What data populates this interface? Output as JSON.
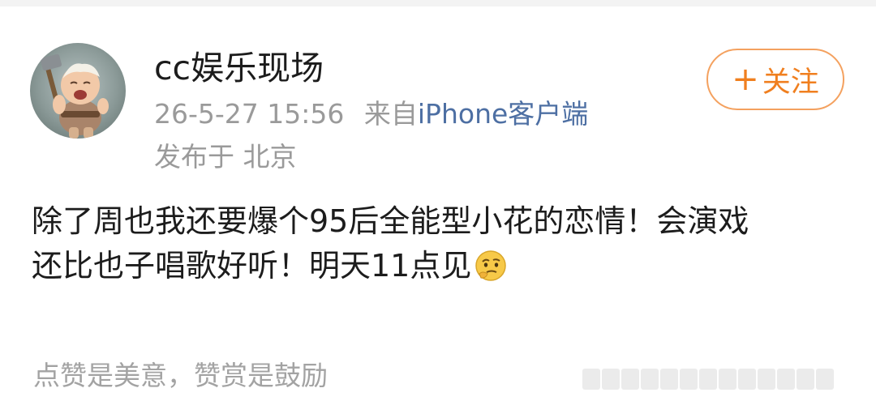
{
  "post": {
    "author": {
      "name": "cc娱乐现场",
      "avatar_icon": "baby-thor-avatar"
    },
    "timestamp": "26-5-27 15:56",
    "source_prefix": "来自",
    "source_device": "iPhone客户端",
    "location": "发布于 北京",
    "follow_button": {
      "plus": "+",
      "label": "关注"
    },
    "text_line_1": "除了周也我还要爆个95后全能型小花的恋情！会演戏",
    "text_line_2": "还比也子唱歌好听！明天11点见",
    "emoji_icon": "thinking-face-emoji",
    "footer_note": "点赞是美意，赞赏是鼓励"
  },
  "colors": {
    "follow_border": "#f4a15f",
    "follow_text": "#f07f1f",
    "device_link": "#4d6fa3",
    "meta_gray": "#9a9a9a"
  }
}
